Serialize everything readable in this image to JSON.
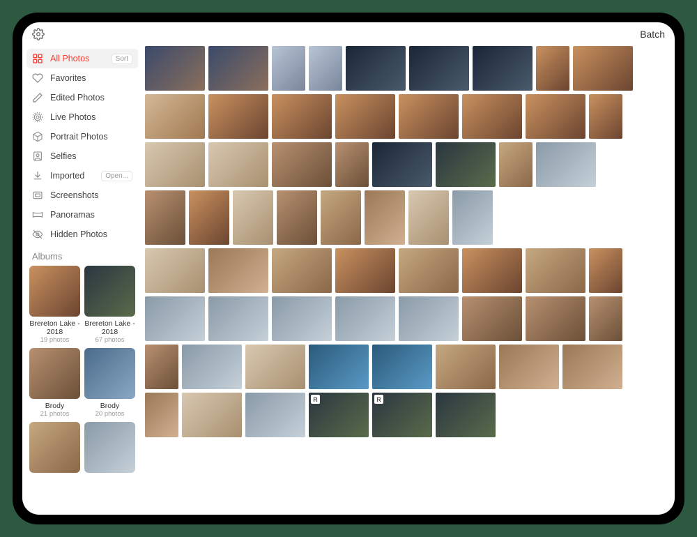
{
  "topbar": {
    "batch_label": "Batch"
  },
  "sidebar": {
    "items": [
      {
        "label": "All Photos",
        "pill": "Sort"
      },
      {
        "label": "Favorites"
      },
      {
        "label": "Edited Photos"
      },
      {
        "label": "Live Photos"
      },
      {
        "label": "Portrait Photos"
      },
      {
        "label": "Selfies"
      },
      {
        "label": "Imported",
        "pill": "Open..."
      },
      {
        "label": "Screenshots"
      },
      {
        "label": "Panoramas"
      },
      {
        "label": "Hidden Photos"
      }
    ],
    "albums_title": "Albums",
    "albums": [
      {
        "name": "Brereton Lake - 2018",
        "count": "19 photos"
      },
      {
        "name": "Brereton Lake - 2018",
        "count": "67 photos"
      },
      {
        "name": "Brody",
        "count": "21 photos"
      },
      {
        "name": "Brody",
        "count": "20 photos"
      },
      {
        "name": "",
        "count": ""
      },
      {
        "name": "",
        "count": ""
      }
    ]
  },
  "badges": {
    "raw": "R"
  },
  "rows": [
    [
      {
        "w": 86,
        "g": 1
      },
      {
        "w": 86,
        "g": 1
      },
      {
        "w": 48,
        "g": 2
      },
      {
        "w": 48,
        "g": 2
      },
      {
        "w": 86,
        "g": 6
      },
      {
        "w": 86,
        "g": 6
      },
      {
        "w": 86,
        "g": 6
      },
      {
        "w": 48,
        "g": 3
      },
      {
        "w": 86,
        "g": 3
      }
    ],
    [
      {
        "w": 86,
        "g": 5
      },
      {
        "w": 86,
        "g": 3
      },
      {
        "w": 86,
        "g": 3
      },
      {
        "w": 86,
        "g": 3
      },
      {
        "w": 86,
        "g": 3
      },
      {
        "w": 86,
        "g": 3
      },
      {
        "w": 86,
        "g": 3
      },
      {
        "w": 48,
        "g": 3
      }
    ],
    [
      {
        "w": 86,
        "g": 10
      },
      {
        "w": 86,
        "g": 10
      },
      {
        "w": 86,
        "g": 9
      },
      {
        "w": 48,
        "g": 9
      },
      {
        "w": 86,
        "g": 6
      },
      {
        "w": 86,
        "g": 4
      },
      {
        "w": 48,
        "g": 12
      },
      {
        "w": 86,
        "g": 7
      }
    ],
    [
      {
        "w": 58,
        "g": 9,
        "h": 78
      },
      {
        "w": 58,
        "g": 3,
        "h": 78
      },
      {
        "w": 58,
        "g": 10,
        "h": 78
      },
      {
        "w": 58,
        "g": 9,
        "h": 78
      },
      {
        "w": 58,
        "g": 12,
        "h": 78
      },
      {
        "w": 58,
        "g": 14,
        "h": 78
      },
      {
        "w": 58,
        "g": 10,
        "h": 78
      },
      {
        "w": 58,
        "g": 7,
        "h": 78
      }
    ],
    [
      {
        "w": 86,
        "g": 10
      },
      {
        "w": 86,
        "g": 14
      },
      {
        "w": 86,
        "g": 12
      },
      {
        "w": 86,
        "g": 3
      },
      {
        "w": 86,
        "g": 12
      },
      {
        "w": 86,
        "g": 3
      },
      {
        "w": 86,
        "g": 12
      },
      {
        "w": 48,
        "g": 3
      }
    ],
    [
      {
        "w": 86,
        "g": 7
      },
      {
        "w": 86,
        "g": 7
      },
      {
        "w": 86,
        "g": 7
      },
      {
        "w": 86,
        "g": 7
      },
      {
        "w": 86,
        "g": 7
      },
      {
        "w": 86,
        "g": 9
      },
      {
        "w": 86,
        "g": 9
      },
      {
        "w": 48,
        "g": 9
      }
    ],
    [
      {
        "w": 48,
        "g": 9
      },
      {
        "w": 86,
        "g": 7
      },
      {
        "w": 86,
        "g": 10
      },
      {
        "w": 86,
        "g": 13
      },
      {
        "w": 86,
        "g": 13
      },
      {
        "w": 86,
        "g": 12
      },
      {
        "w": 86,
        "g": 14
      },
      {
        "w": 86,
        "g": 14
      }
    ],
    [
      {
        "w": 48,
        "g": 14
      },
      {
        "w": 86,
        "g": 10
      },
      {
        "w": 86,
        "g": 7
      },
      {
        "w": 86,
        "g": 4,
        "badge": "raw"
      },
      {
        "w": 86,
        "g": 4,
        "badge": "raw"
      },
      {
        "w": 86,
        "g": 4
      }
    ]
  ]
}
